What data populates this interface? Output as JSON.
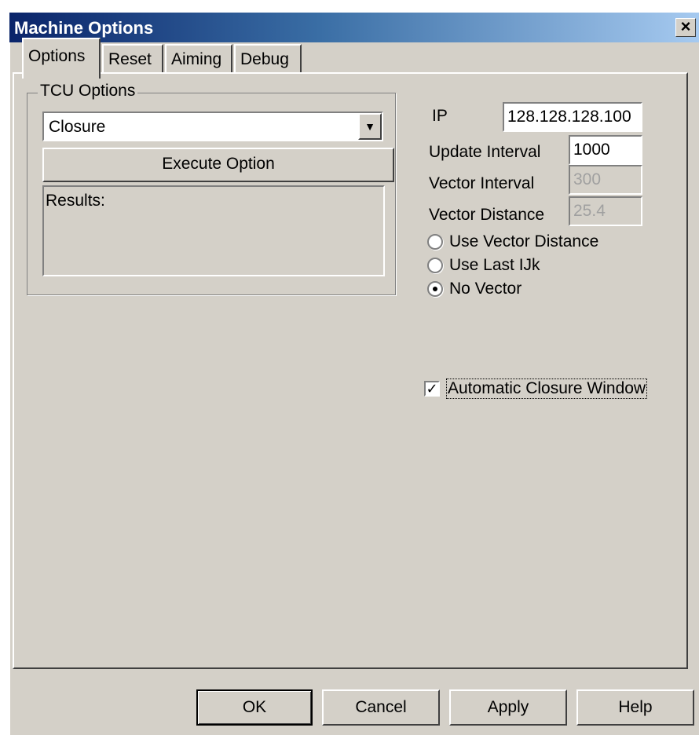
{
  "window": {
    "title": "Machine Options",
    "close_glyph": "×"
  },
  "tabs": [
    {
      "label": "Options",
      "active": true
    },
    {
      "label": "Reset",
      "active": false
    },
    {
      "label": "Aiming",
      "active": false
    },
    {
      "label": "Debug",
      "active": false
    }
  ],
  "tcu_options": {
    "group_label": "TCU Options",
    "selected_option": "Closure",
    "execute_button_label": "Execute Option",
    "results_label": "Results:"
  },
  "settings": {
    "ip_label": "IP",
    "ip_value": "128.128.128.100",
    "update_interval_label": "Update Interval",
    "update_interval_value": "1000",
    "vector_interval_label": "Vector Interval",
    "vector_interval_value": "300",
    "vector_distance_label": "Vector Distance",
    "vector_distance_value": "25.4"
  },
  "vector_mode": {
    "options": [
      "Use Vector Distance",
      "Use Last IJk",
      "No Vector"
    ],
    "selected": "No Vector"
  },
  "auto_closure": {
    "label": "Automatic Closure Window",
    "checked": true
  },
  "footer": {
    "ok_label": "OK",
    "cancel_label": "Cancel",
    "apply_label": "Apply",
    "help_label": "Help"
  },
  "colors": {
    "dialog_face": "#d4d0c8",
    "titlebar_start": "#0a246a",
    "titlebar_end": "#a6caf0"
  }
}
